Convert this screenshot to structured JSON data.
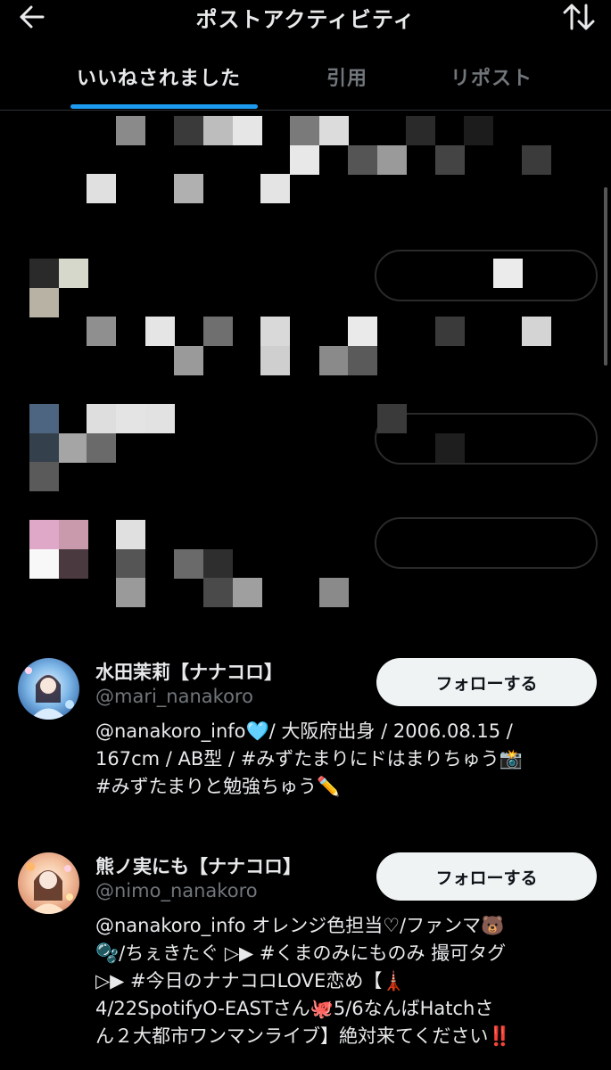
{
  "header": {
    "title": "ポストアクティビティ",
    "back_icon": "arrow-left-icon",
    "sort_icon": "sort-arrows-icon"
  },
  "tabs": [
    {
      "label": "いいねされました",
      "active": true
    },
    {
      "label": "引用",
      "active": false
    },
    {
      "label": "リポスト",
      "active": false
    }
  ],
  "colors": {
    "accent": "#1d9bf0",
    "background": "#000000",
    "text": "#e7e9ea",
    "muted": "#71767b",
    "button_bg": "#eff3f4"
  },
  "users": [
    {
      "display_name": "水田茉莉【ナナコロ】",
      "handle": "@mari_nanakoro",
      "follow_label": "フォローする",
      "bio_lines": [
        "@nanakoro_info🩵/ 大阪府出身 / 2006.08.15 /",
        "167cm / AB型 / #みずたまりにドはまりちゅう📸",
        "#みずたまりと勉強ちゅう✏️"
      ]
    },
    {
      "display_name": "熊ノ実にも【ナナコロ】",
      "handle": "@nimo_nanakoro",
      "follow_label": "フォローする",
      "bio_lines": [
        "@nanakoro_info オレンジ色担当♡/ファンマ🐻",
        "🫧/ちぇきたぐ ▷▶ #くまのみにものみ 撮可タグ",
        "▷▶ #今日のナナコロLOVE恋め【🗼",
        "4/22SpotifyO-EASTさん🐙5/6なんばHatchさ",
        "ん２大都市ワンマンライブ】絶対来てください‼️"
      ]
    }
  ]
}
